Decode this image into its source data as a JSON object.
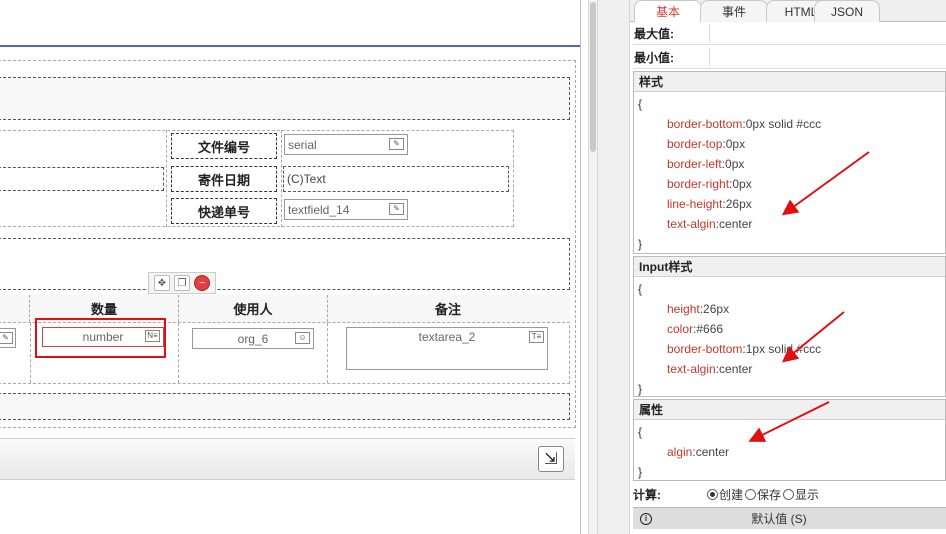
{
  "tabs": [
    {
      "label": "基本",
      "active": true
    },
    {
      "label": "事件",
      "active": false
    },
    {
      "label": "HTML",
      "active": false
    },
    {
      "label": "JSON",
      "active": false
    }
  ],
  "props": {
    "max_label": "最大值:",
    "min_label": "最小值:"
  },
  "style_section": {
    "title": "样式",
    "open": "{",
    "close": "}",
    "lines": [
      {
        "k": "border-bottom",
        "v": "0px solid #ccc"
      },
      {
        "k": "border-top",
        "v": "0px"
      },
      {
        "k": "border-left",
        "v": "0px"
      },
      {
        "k": "border-right",
        "v": "0px"
      },
      {
        "k": "line-height",
        "v": "26px"
      },
      {
        "k": "text-algin",
        "v": "center"
      }
    ]
  },
  "input_section": {
    "title": "Input样式",
    "open": "{",
    "close": "}",
    "lines": [
      {
        "k": "height",
        "v": "26px"
      },
      {
        "k": "color",
        "v": "#666"
      },
      {
        "k": "border-bottom",
        "v": "1px solid #ccc"
      },
      {
        "k": "text-algin",
        "v": "center"
      }
    ]
  },
  "attr_section": {
    "title": "属性",
    "open": "{",
    "close": "}",
    "lines": [
      {
        "k": "algin",
        "v": "center"
      }
    ]
  },
  "separator": ":",
  "calc": {
    "label": "计算:",
    "options": [
      {
        "label": "创建",
        "checked": true
      },
      {
        "label": "保存",
        "checked": false
      },
      {
        "label": "显示",
        "checked": false
      }
    ]
  },
  "default_bar": {
    "info_glyph": "i",
    "label": "默认值 (S)"
  },
  "form": {
    "rows": [
      {
        "label": "文件编号",
        "field": "serial",
        "icon": "edit-icon"
      },
      {
        "label": "寄件日期",
        "field": "(C)Text",
        "icon": ""
      },
      {
        "label": "快递单号",
        "field": "textfield_14",
        "icon": "edit-icon"
      }
    ],
    "table_headers": [
      "数量",
      "使用人",
      "备注"
    ],
    "cells": {
      "number": "number",
      "number_badge": "N≡",
      "org": "org_6",
      "textarea": "textarea_2",
      "textarea_badge": "T≡"
    }
  },
  "colors": {
    "accent": "#e23b2e",
    "arrow": "#e01010",
    "key": "#c0392b"
  }
}
